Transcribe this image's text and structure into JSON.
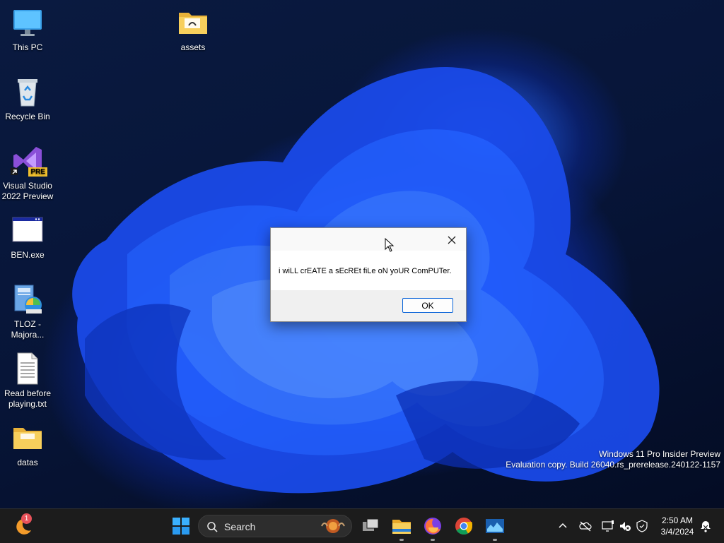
{
  "desktop_icons": [
    {
      "label": "This PC",
      "icon": "monitor-icon"
    },
    {
      "label": "assets",
      "icon": "folder-icon"
    },
    {
      "label": "Recycle Bin",
      "icon": "recycle-bin-icon"
    },
    {
      "label": "Visual Studio\n2022 Preview",
      "icon": "visual-studio-icon",
      "badge": "PRE"
    },
    {
      "label": "BEN.exe",
      "icon": "window-app-icon"
    },
    {
      "label": "TLOZ -\nMajora...",
      "icon": "installer-icon"
    },
    {
      "label": "Read before\nplaying.txt",
      "icon": "text-file-icon"
    },
    {
      "label": "datas",
      "icon": "folder-icon"
    }
  ],
  "dialog": {
    "title": "",
    "message": "i wiLL crEATE a sEcREt fiLe oN yoUR ComPUTer.",
    "ok_label": "OK"
  },
  "watermark": {
    "line1": "Windows 11 Pro Insider Preview",
    "line2": "Evaluation copy. Build 26040.rs_prerelease.240122-1157"
  },
  "taskbar": {
    "search_placeholder": "Search",
    "notification_count": "1",
    "clock_time": "2:50 AM",
    "clock_date": "3/4/2024",
    "pinned": [
      "start-icon",
      "search-icon",
      "task-view-icon",
      "file-explorer-icon",
      "firefox-icon",
      "chrome-icon",
      "app-icon"
    ]
  },
  "colors": {
    "accent": "#0a64d8",
    "taskbar": "#1c1c1c",
    "wallpaper_blue": "#1e5cff"
  }
}
